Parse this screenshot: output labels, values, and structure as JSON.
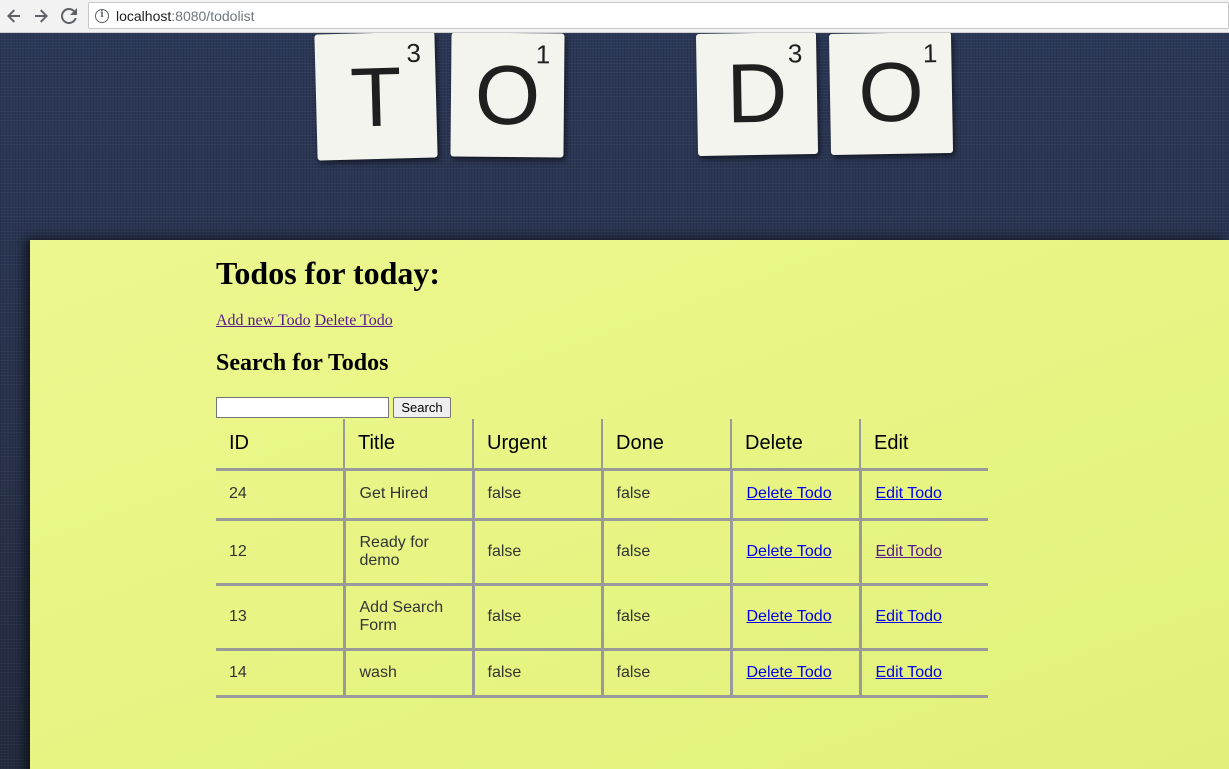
{
  "browser": {
    "url_host": "localhost",
    "url_rest": ":8080/todolist",
    "info_glyph": "i"
  },
  "banner": {
    "tiles": [
      {
        "letter": "T",
        "score": "3"
      },
      {
        "letter": "O",
        "score": "1"
      },
      {
        "letter": "D",
        "score": "3"
      },
      {
        "letter": "O",
        "score": "1"
      }
    ]
  },
  "page": {
    "title": "Todos for today:",
    "add_link": "Add new Todo",
    "delete_link": "Delete Todo",
    "search_heading": "Search for Todos",
    "search_value": "",
    "search_button": "Search"
  },
  "table": {
    "headers": [
      "ID",
      "Title",
      "Urgent",
      "Done",
      "Delete",
      "Edit"
    ],
    "rows": [
      {
        "id": "24",
        "title": "Get Hired",
        "urgent": "false",
        "done": "false",
        "delete": "Delete Todo",
        "edit": "Edit Todo"
      },
      {
        "id": "12",
        "title": "Ready for demo",
        "urgent": "false",
        "done": "false",
        "delete": "Delete Todo",
        "edit": "Edit Todo"
      },
      {
        "id": "13",
        "title": "Add Search Form",
        "urgent": "false",
        "done": "false",
        "delete": "Delete Todo",
        "edit": "Edit Todo"
      },
      {
        "id": "14",
        "title": "wash",
        "urgent": "false",
        "done": "false",
        "delete": "Delete Todo",
        "edit": "Edit Todo"
      }
    ]
  },
  "colors": {
    "note": "#e8f584",
    "backdrop": "#2a3550",
    "link": "#0000ee",
    "visited_link": "#551a8b"
  }
}
